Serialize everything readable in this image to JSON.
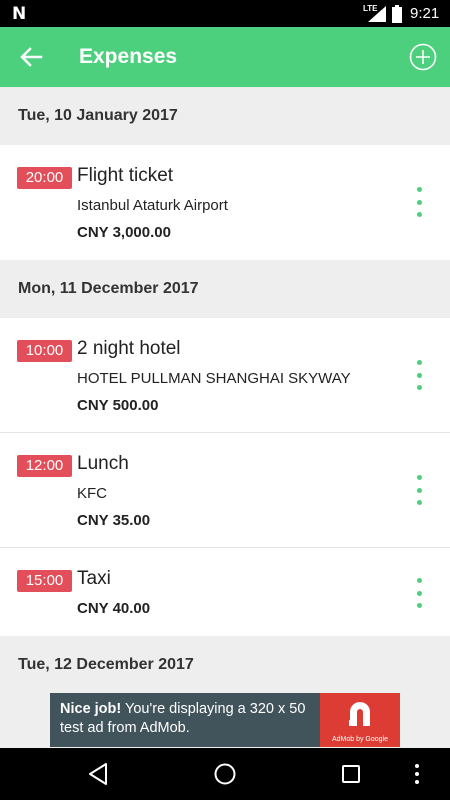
{
  "status_bar": {
    "network": "LTE",
    "time": "9:21"
  },
  "app_bar": {
    "title": "Expenses",
    "back_icon": "arrow-left-icon",
    "add_icon": "add-circle-icon"
  },
  "groups": [
    {
      "date": "Tue, 10 January 2017",
      "items": [
        {
          "time": "20:00",
          "title": "Flight ticket",
          "place": "Istanbul Ataturk Airport",
          "amount": "CNY 3,000.00"
        }
      ]
    },
    {
      "date": "Mon, 11 December 2017",
      "items": [
        {
          "time": "10:00",
          "title": "2 night hotel",
          "place": "HOTEL PULLMAN SHANGHAI SKYWAY",
          "amount": "CNY 500.00"
        },
        {
          "time": "12:00",
          "title": "Lunch",
          "place": "KFC",
          "amount": "CNY 35.00"
        },
        {
          "time": "15:00",
          "title": "Taxi",
          "place": "",
          "amount": "CNY 40.00"
        }
      ]
    },
    {
      "date": "Tue, 12 December 2017",
      "items": []
    }
  ],
  "ad": {
    "bold": "Nice job!",
    "text": " You're displaying a 320 x 50 test ad from AdMob.",
    "by": "AdMob by Google"
  },
  "colors": {
    "accent": "#4cd07d",
    "time_badge": "#e24f5a",
    "ad_background": "#41535b",
    "ad_logo": "#dc3c34"
  }
}
